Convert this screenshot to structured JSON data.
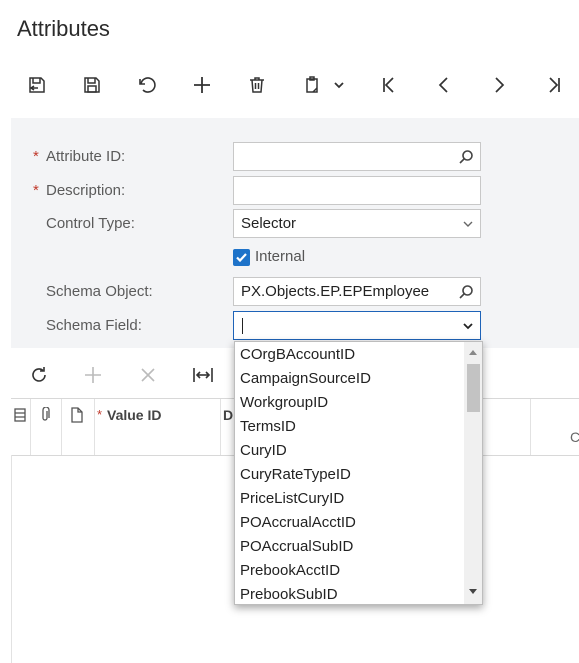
{
  "page": {
    "title": "Attributes"
  },
  "toolbar": {
    "buttons": [
      {
        "name": "save-close-icon"
      },
      {
        "name": "save-icon"
      },
      {
        "name": "undo-icon"
      },
      {
        "name": "add-icon"
      },
      {
        "name": "delete-icon"
      },
      {
        "name": "copy-paste-icon"
      },
      {
        "name": "first-record-icon"
      },
      {
        "name": "previous-record-icon"
      },
      {
        "name": "next-record-icon"
      },
      {
        "name": "last-record-icon"
      }
    ]
  },
  "form": {
    "attribute_id": {
      "label": "Attribute ID:",
      "value": "",
      "required": true
    },
    "description": {
      "label": "Description:",
      "value": "",
      "required": true
    },
    "control_type": {
      "label": "Control Type:",
      "value": "Selector"
    },
    "internal": {
      "label": "Internal",
      "checked": true
    },
    "schema_object": {
      "label": "Schema Object:",
      "value": "PX.Objects.EP.EPEmployee"
    },
    "schema_field": {
      "label": "Schema Field:",
      "value": ""
    },
    "required_mark": "*"
  },
  "grid": {
    "headers": {
      "value_id": "Value ID",
      "d_col": "D",
      "c_col": "C"
    },
    "required_mark": "*"
  },
  "dropdown": {
    "options": [
      "COrgBAccountID",
      "CampaignSourceID",
      "WorkgroupID",
      "TermsID",
      "CuryID",
      "CuryRateTypeID",
      "PriceListCuryID",
      "POAccrualAcctID",
      "POAccrualSubID",
      "PrebookAcctID",
      "PrebookSubID"
    ]
  },
  "colors": {
    "accent": "#1e73c9",
    "required": "#c0392b",
    "panel": "#f3f4f6"
  }
}
